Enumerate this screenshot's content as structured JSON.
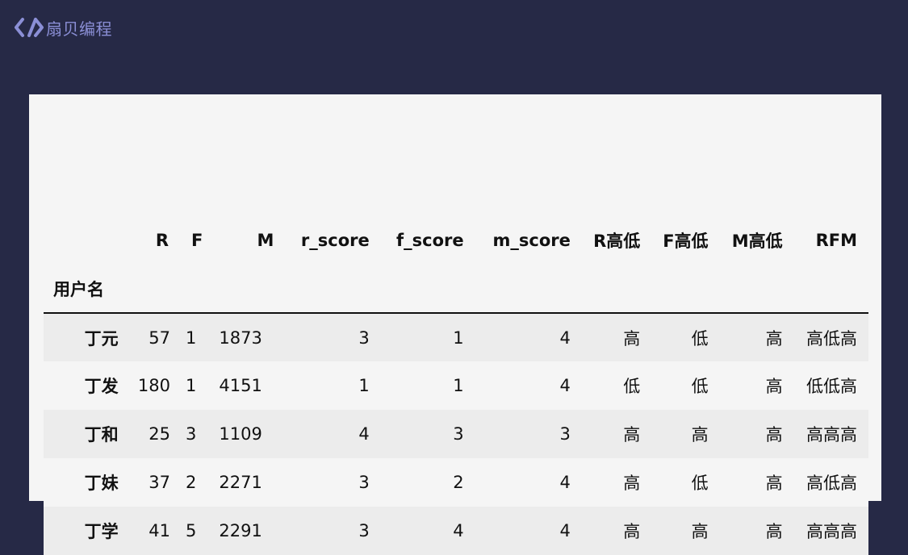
{
  "brand": {
    "name": "扇贝编程",
    "icon": "code-brackets-icon",
    "color": "#8b8fd6"
  },
  "colors": {
    "background": "#262946",
    "panel": "#f5f5f5",
    "row_stripe": "#ececec"
  },
  "table": {
    "columns": [
      "R",
      "F",
      "M",
      "r_score",
      "f_score",
      "m_score",
      "R高低",
      "F高低",
      "M高低",
      "RFM"
    ],
    "index_name": "用户名",
    "rows": [
      {
        "name": "丁元",
        "cells": [
          "57",
          "1",
          "1873",
          "3",
          "1",
          "4",
          "高",
          "低",
          "高",
          "高低高"
        ]
      },
      {
        "name": "丁发",
        "cells": [
          "180",
          "1",
          "4151",
          "1",
          "1",
          "4",
          "低",
          "低",
          "高",
          "低低高"
        ]
      },
      {
        "name": "丁和",
        "cells": [
          "25",
          "3",
          "1109",
          "4",
          "3",
          "3",
          "高",
          "高",
          "高",
          "高高高"
        ]
      },
      {
        "name": "丁妹",
        "cells": [
          "37",
          "2",
          "2271",
          "3",
          "2",
          "4",
          "高",
          "低",
          "高",
          "高低高"
        ]
      },
      {
        "name": "丁学",
        "cells": [
          "41",
          "5",
          "2291",
          "3",
          "4",
          "4",
          "高",
          "高",
          "高",
          "高高高"
        ]
      }
    ]
  }
}
